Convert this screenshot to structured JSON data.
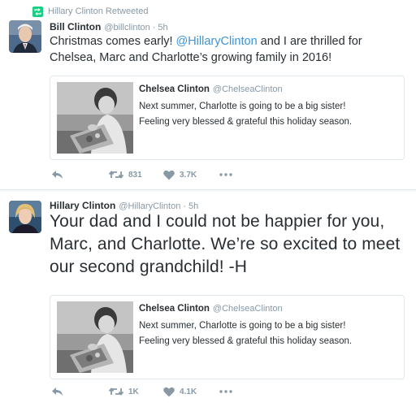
{
  "tweet1": {
    "retweet_label": "Hillary Clinton Retweeted",
    "name": "Bill Clinton",
    "handle": "@billclinton",
    "dot": "·",
    "time": "5h",
    "text_part1": "Christmas comes early! ",
    "mention": "@HillaryClinton",
    "text_part2": " and I are thrilled for Chelsea, Marc and Charlotte’s growing family in 2016!",
    "quote": {
      "name": "Chelsea Clinton",
      "handle": "@ChelseaClinton",
      "line1": "Next summer, Charlotte is going to be a big sister!",
      "line2": "Feeling very blessed & grateful this holiday season."
    },
    "retweets": "831",
    "likes": "3.7K"
  },
  "tweet2": {
    "name": "Hillary Clinton",
    "handle": "@HillaryClinton",
    "dot": "·",
    "time": "5h",
    "text": "Your dad and I could not be happier for you, Marc, and Charlotte. We’re so excited to meet our second grandchild! -H",
    "quote": {
      "name": "Chelsea Clinton",
      "handle": "@ChelseaClinton",
      "line1": "Next summer, Charlotte is going to be a big sister!",
      "line2": "Feeling very blessed & grateful this holiday season."
    },
    "retweets": "1K",
    "likes": "4.1K"
  },
  "icons": {
    "retweeted": "retweet-icon",
    "reply": "reply-icon",
    "retweet": "retweet-icon",
    "like": "heart-icon",
    "more": "more-icon"
  },
  "colors": {
    "link": "#3b94d9",
    "retweeted_green": "#19cf86",
    "muted": "#8899a6",
    "text": "#292f33",
    "border": "#e1e8ed"
  }
}
